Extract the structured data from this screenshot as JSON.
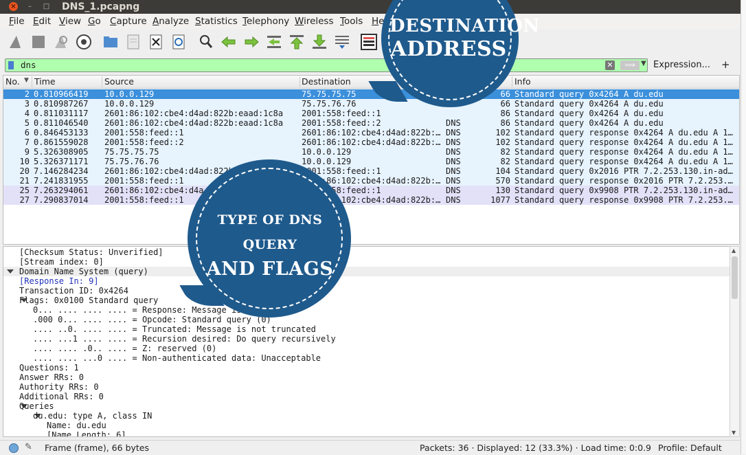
{
  "window": {
    "title": "DNS_1.pcapng",
    "close": "×",
    "minimize": "–",
    "maximize": "□"
  },
  "menu": [
    "File",
    "Edit",
    "View",
    "Go",
    "Capture",
    "Analyze",
    "Statistics",
    "Telephony",
    "Wireless",
    "Tools",
    "He"
  ],
  "filter": {
    "value": "dns",
    "expression_label": "Expression...",
    "add_label": "+",
    "clear": "✕",
    "apply": "⟹"
  },
  "packet_list": {
    "columns": [
      "No.",
      "Time",
      "Source",
      "Destination",
      "Protocol",
      "Length",
      "Info"
    ],
    "visible_headers": {
      "no": "No.",
      "time": "Time",
      "source": "Source",
      "destination": "Destination",
      "info": "Info"
    },
    "rows": [
      {
        "no": "2",
        "time": "0.810966419",
        "src": "10.0.0.129",
        "dst": "75.75.75.75",
        "proto": "",
        "len": "66",
        "info": "Standard query 0x4264 A du.edu",
        "selected": true
      },
      {
        "no": "3",
        "time": "0.810987267",
        "src": "10.0.0.129",
        "dst": "75.75.76.76",
        "proto": "",
        "len": "66",
        "info": "Standard query 0x4264 A du.edu"
      },
      {
        "no": "4",
        "time": "0.811031117",
        "src": "2601:86:102:cbe4:d4ad:822b:eaad:1c8a",
        "dst": "2001:558:feed::1",
        "proto": "",
        "len": "86",
        "info": "Standard query 0x4264 A du.edu"
      },
      {
        "no": "5",
        "time": "0.811046540",
        "src": "2601:86:102:cbe4:d4ad:822b:eaad:1c8a",
        "dst": "2001:558:feed::2",
        "proto": "DNS",
        "len": "86",
        "info": "Standard query 0x4264 A du.edu"
      },
      {
        "no": "6",
        "time": "0.846453133",
        "src": "2001:558:feed::1",
        "dst": "2601:86:102:cbe4:d4ad:822b:…",
        "proto": "DNS",
        "len": "102",
        "info": "Standard query response 0x4264 A du.edu A 1…"
      },
      {
        "no": "7",
        "time": "0.861559028",
        "src": "2001:558:feed::2",
        "dst": "2601:86:102:cbe4:d4ad:822b:…",
        "proto": "DNS",
        "len": "102",
        "info": "Standard query response 0x4264 A du.edu A 1…"
      },
      {
        "no": "9",
        "time": "5.326308905",
        "src": "75.75.75.75",
        "dst": "10.0.0.129",
        "proto": "DNS",
        "len": "82",
        "info": "Standard query response 0x4264 A du.edu A 1…"
      },
      {
        "no": "10",
        "time": "5.326371171",
        "src": "75.75.76.76",
        "dst": "10.0.0.129",
        "proto": "DNS",
        "len": "82",
        "info": "Standard query response 0x4264 A du.edu A 1…"
      },
      {
        "no": "20",
        "time": "7.146284234",
        "src": "2601:86:102:cbe4:d4ad:822b",
        "dst": "2001:558:feed::1",
        "proto": "DNS",
        "len": "104",
        "info": "Standard query 0x2016 PTR 7.2.253.130.in-ad…"
      },
      {
        "no": "21",
        "time": "7.241831955",
        "src": "2001:558:feed::1",
        "dst": "2601:86:102:cbe4:d4ad:822b:…",
        "proto": "DNS",
        "len": "570",
        "info": "Standard query response 0x2016 PTR 7.2.253.…"
      },
      {
        "no": "25",
        "time": "7.263294061",
        "src": "2601:86:102:cbe4:d4a",
        "dst": "2001:558:feed::1",
        "proto": "DNS",
        "len": "130",
        "info": "Standard query 0x9908 PTR 7.2.253.130.in-ad…"
      },
      {
        "no": "27",
        "time": "7.290837014",
        "src": "2001:558:feed::1",
        "dst": "2601:86:102:cbe4:d4ad:822b:…",
        "proto": "DNS",
        "len": "1077",
        "info": "Standard query response 0x9908 PTR 7.2.253.…"
      }
    ]
  },
  "details": {
    "lines": [
      {
        "text": "[Checksum Status: Unverified]",
        "indent": 2
      },
      {
        "text": "[Stream index: 0]",
        "indent": 2
      },
      {
        "text": "Domain Name System (query)",
        "indent": 1,
        "expanded": true,
        "highlight": true
      },
      {
        "text": "[Response In: 9]",
        "indent": 2,
        "link": true
      },
      {
        "text": "Transaction ID: 0x4264",
        "indent": 2
      },
      {
        "text": "Flags: 0x0100 Standard query",
        "indent": 2,
        "expanded": true
      },
      {
        "text": "0... .... .... .... = Response: Message is a query",
        "indent": 3
      },
      {
        "text": ".000 0... .... .... = Opcode: Standard query (0)",
        "indent": 3
      },
      {
        "text": ".... ..0. .... .... = Truncated: Message is not truncated",
        "indent": 3
      },
      {
        "text": ".... ...1 .... .... = Recursion desired: Do query recursively",
        "indent": 3
      },
      {
        "text": ".... .... .0.. .... = Z: reserved (0)",
        "indent": 3
      },
      {
        "text": ".... .... ...0 .... = Non-authenticated data: Unacceptable",
        "indent": 3
      },
      {
        "text": "Questions: 1",
        "indent": 2
      },
      {
        "text": "Answer RRs: 0",
        "indent": 2
      },
      {
        "text": "Authority RRs: 0",
        "indent": 2
      },
      {
        "text": "Additional RRs: 0",
        "indent": 2
      },
      {
        "text": "Queries",
        "indent": 2,
        "expanded": true
      },
      {
        "text": "du.edu: type A, class IN",
        "indent": 3,
        "expanded": true
      },
      {
        "text": "Name: du.edu",
        "indent": 4
      },
      {
        "text": "[Name Length: 6]",
        "indent": 4
      }
    ]
  },
  "status": {
    "frame": "Frame (frame), 66 bytes",
    "packets": "Packets: 36 · Displayed: 12 (33.3%) · Load time: 0:0.9",
    "profile": "Profile: Default"
  },
  "callouts": {
    "destination": [
      "DESTINATION",
      "ADDRESS"
    ],
    "dns_type": [
      "TYPE OF DNS QUERY",
      "AND FLAGS"
    ]
  },
  "colors": {
    "selected_row": "#3b8fdb",
    "row_light_blue": "#e7f3fd",
    "row_lavender": "#e3e1f8",
    "filter_ok": "#afffaf",
    "callout": "#1f5a8c"
  }
}
